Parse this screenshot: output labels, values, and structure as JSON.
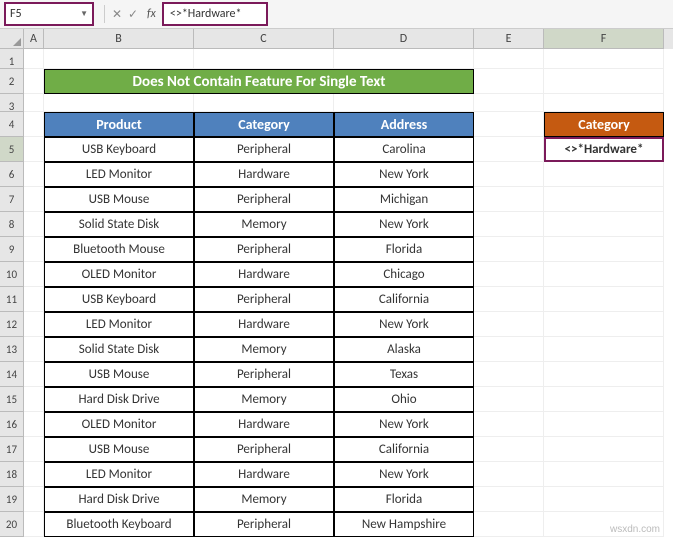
{
  "name_box": "F5",
  "formula_text": "<>*Hardware*",
  "columns": [
    "A",
    "B",
    "C",
    "D",
    "E",
    "F"
  ],
  "title": "Does Not Contain Feature For Single Text",
  "headers": {
    "product": "Product",
    "category": "Category",
    "address": "Address",
    "side_category": "Category"
  },
  "side_value": "<>*Hardware*",
  "rows": [
    {
      "n": 5,
      "p": "USB Keyboard",
      "c": "Peripheral",
      "a": "Carolina"
    },
    {
      "n": 6,
      "p": "LED Monitor",
      "c": "Hardware",
      "a": "New York"
    },
    {
      "n": 7,
      "p": "USB Mouse",
      "c": "Peripheral",
      "a": "Michigan"
    },
    {
      "n": 8,
      "p": "Solid State Disk",
      "c": "Memory",
      "a": "New York"
    },
    {
      "n": 9,
      "p": "Bluetooth Mouse",
      "c": "Peripheral",
      "a": "Florida"
    },
    {
      "n": 10,
      "p": "OLED Monitor",
      "c": "Hardware",
      "a": "Chicago"
    },
    {
      "n": 11,
      "p": "USB Keyboard",
      "c": "Peripheral",
      "a": "California"
    },
    {
      "n": 12,
      "p": "LED Monitor",
      "c": "Hardware",
      "a": "New York"
    },
    {
      "n": 13,
      "p": "Solid State Disk",
      "c": "Memory",
      "a": "Alaska"
    },
    {
      "n": 14,
      "p": "USB Mouse",
      "c": "Peripheral",
      "a": "Texas"
    },
    {
      "n": 15,
      "p": "Hard Disk Drive",
      "c": "Memory",
      "a": "Ohio"
    },
    {
      "n": 16,
      "p": "OLED Monitor",
      "c": "Hardware",
      "a": "New York"
    },
    {
      "n": 17,
      "p": "USB Mouse",
      "c": "Peripheral",
      "a": "California"
    },
    {
      "n": 18,
      "p": "LED Monitor",
      "c": "Hardware",
      "a": "New York"
    },
    {
      "n": 19,
      "p": "Hard Disk Drive",
      "c": "Memory",
      "a": "Florida"
    },
    {
      "n": 20,
      "p": "Bluetooth Keyboard",
      "c": "Peripheral",
      "a": "New Hampshire"
    }
  ],
  "watermark": "wsxdn.com"
}
